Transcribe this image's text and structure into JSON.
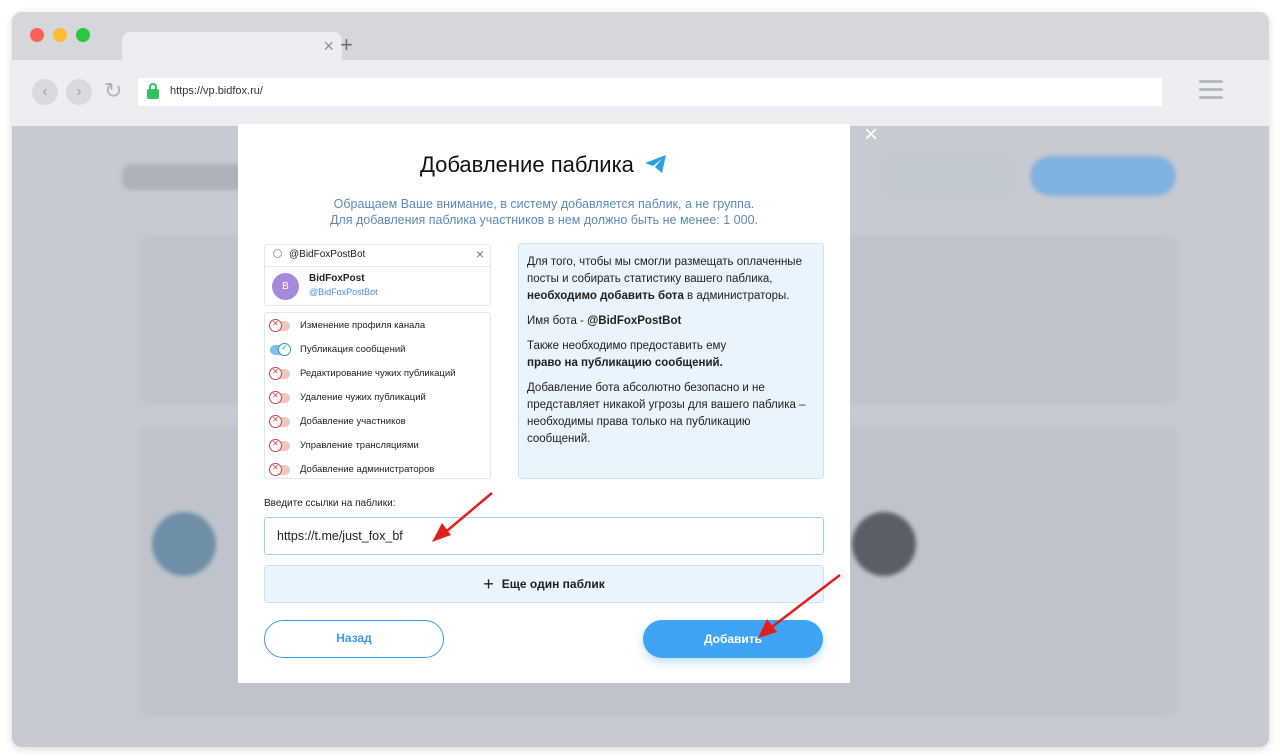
{
  "browser": {
    "url": "https://vp.bidfox.ru/",
    "tab_close": "×",
    "tab_new": "+"
  },
  "modal": {
    "title": "Добавление паблика",
    "close": "×",
    "notice_line1": "Обращаем Ваше внимание, в систему добавляется паблик, а не группа.",
    "notice_line2": "Для добавления паблика участников в нем должно быть не менее: 1 000.",
    "search_value": "@BidFoxPostBot",
    "bot": {
      "avatar_letter": "B",
      "name": "BidFoxPost",
      "handle": "@BidFoxPostBot"
    },
    "permissions": [
      {
        "label": "Изменение профиля канала",
        "enabled": false
      },
      {
        "label": "Публикация сообщений",
        "enabled": true
      },
      {
        "label": "Редактирование чужих публикаций",
        "enabled": false
      },
      {
        "label": "Удаление чужих публикаций",
        "enabled": false
      },
      {
        "label": "Добавление участников",
        "enabled": false
      },
      {
        "label": "Управление трансляциями",
        "enabled": false
      },
      {
        "label": "Добавление администраторов",
        "enabled": false
      }
    ],
    "info": {
      "p1_start": "Для того, чтобы мы смогли размещать оплаченные посты и собирать статистику вашего паблика, ",
      "p1_bold": "необходимо добавить бота",
      "p1_end": " в администраторы.",
      "p2_start": "Имя бота - ",
      "p2_bold": "@BidFoxPostBot",
      "p3_start": "Также необходимо предоставить ему ",
      "p3_bold": "право на публикацию сообщений.",
      "p4": "Добавление бота абсолютно безопасно и не представляет никакой угрозы для вашего паблика – необходимы права только на публикацию сообщений."
    },
    "links_label": "Введите ссылки на паблики:",
    "link_value": "https://t.me/just_fox_bf",
    "add_more": "Еще один паблик",
    "back_button": "Назад",
    "add_button": "Добавить"
  },
  "colors": {
    "accent": "#3ea3f3",
    "arrow": "#e31e1e",
    "info_bg": "#eaf4fc"
  }
}
